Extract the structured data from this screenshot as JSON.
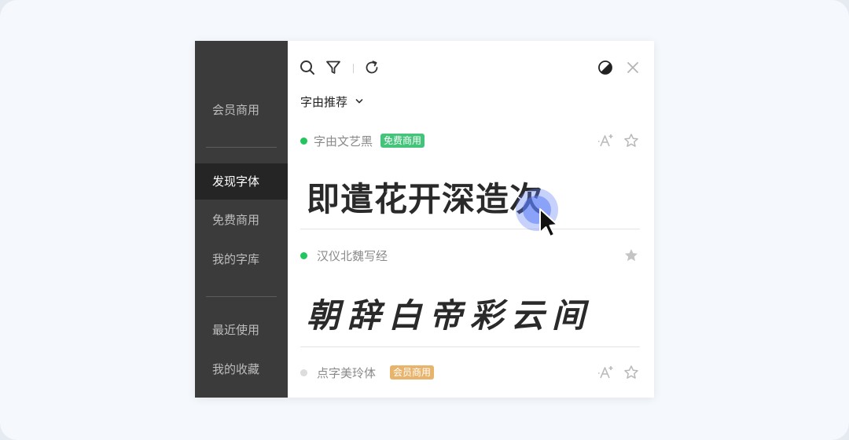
{
  "sidebar": {
    "items": [
      {
        "label": "会员商用",
        "active": false
      },
      {
        "label": "发现字体",
        "active": true
      },
      {
        "label": "免费商用",
        "active": false
      },
      {
        "label": "我的字库",
        "active": false
      },
      {
        "label": "最近使用",
        "active": false
      },
      {
        "label": "我的收藏",
        "active": false
      }
    ]
  },
  "toolbar": {
    "icons": [
      "search-icon",
      "filter-icon",
      "refresh-icon",
      "theme-toggle-icon",
      "close-icon"
    ]
  },
  "filter": {
    "selected": "字由推荐"
  },
  "fonts": [
    {
      "name": "字由文艺黑",
      "badge": "免费商用",
      "status_color": "#22c55e",
      "badge_color": "#43c47a",
      "sample": "即遣花开深造次",
      "favorited": false
    },
    {
      "name": "汉仪北魏写经",
      "badge": "",
      "status_color": "#22c55e",
      "sample": "朝辞白帝彩云间",
      "favorited": true
    },
    {
      "name": "点字美玲体",
      "badge": "会员商用",
      "status_color": "#dcdcdc",
      "badge_color": "#e8b36a",
      "sample": "",
      "favorited": false
    }
  ],
  "colors": {
    "sidebar_bg": "#3b3b3b",
    "sidebar_active_bg": "#252525",
    "accent_cursor": "#5b7cf5"
  }
}
